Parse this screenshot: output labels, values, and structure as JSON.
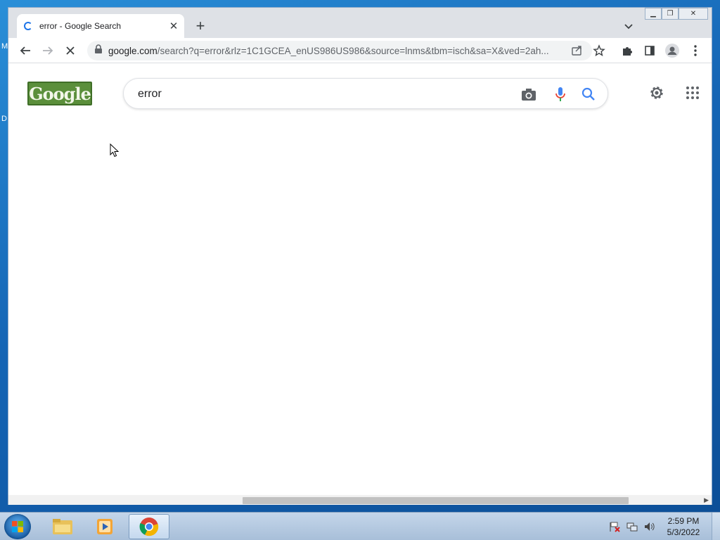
{
  "desktop": {
    "edge_letters": [
      "M",
      "D"
    ]
  },
  "browser": {
    "tab": {
      "title": "error - Google Search"
    },
    "address_bar": {
      "host": "google.com",
      "path": "/search?q=error&rlz=1C1GCEA_enUS986US986&source=lnms&tbm=isch&sa=X&ved=2ah..."
    }
  },
  "page": {
    "logo_text": "Google",
    "search": {
      "value": "error"
    }
  },
  "taskbar": {
    "time": "2:59 PM",
    "date": "5/3/2022"
  },
  "colors": {
    "accent": "#1a73e8",
    "mic_red": "#ea4335",
    "logo_green": "#5b8f3b"
  }
}
